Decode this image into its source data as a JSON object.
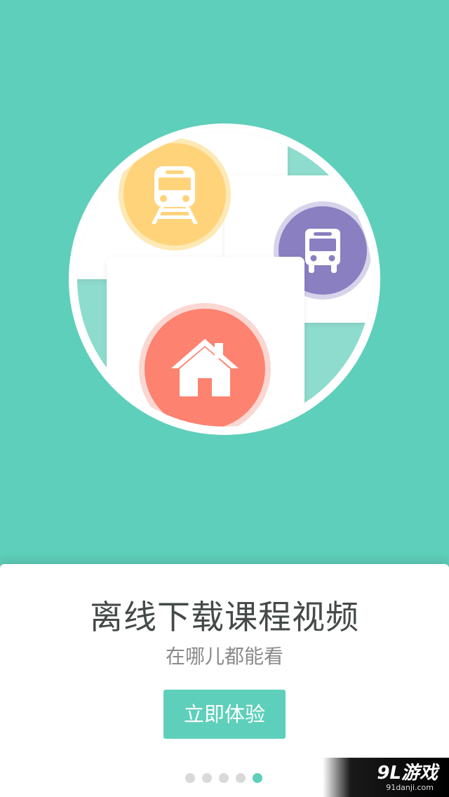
{
  "colors": {
    "background": "#5ecfba",
    "train_badge": "#ffd37a",
    "bus_badge": "#8a7fc1",
    "home_badge": "#fd8270",
    "button": "#5ecfba",
    "dot_active": "#5ecfba",
    "dot_inactive": "#d9d9d9"
  },
  "hero": {
    "icons": [
      "train-icon",
      "bus-icon",
      "home-icon"
    ]
  },
  "panel": {
    "title": "离线下载课程视频",
    "subtitle": "在哪儿都能看",
    "cta_label": "立即体验"
  },
  "pager": {
    "total": 5,
    "active_index": 5
  },
  "watermark": {
    "logo": "9L游戏",
    "url": "91danji.com"
  }
}
